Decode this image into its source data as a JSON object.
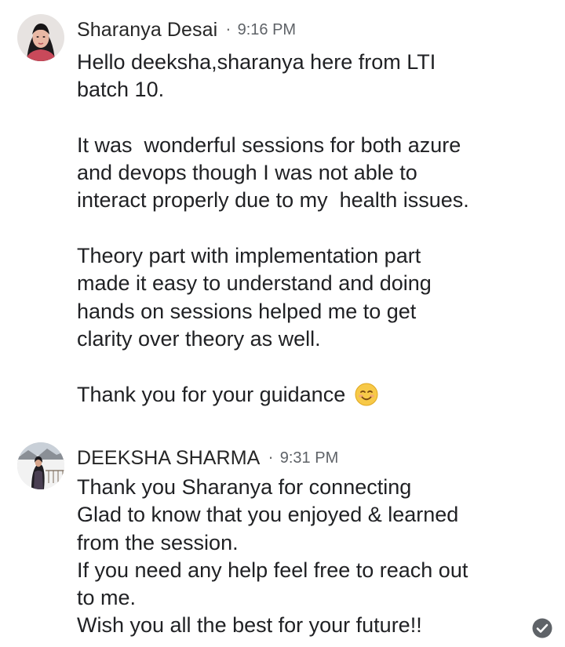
{
  "messages": [
    {
      "sender": "Sharanya Desai",
      "separator": "·",
      "time": "9:16 PM",
      "avatar_icon": "female-profile-photo",
      "lines": [
        "Hello deeksha,sharanya here from LTI",
        "batch 10.",
        "",
        "It was  wonderful sessions for both azure",
        "and devops though I was not able to",
        "interact properly due to my  health issues.",
        "",
        "Theory part with implementation part",
        "made it easy to understand and doing",
        "hands on sessions helped me to get",
        "clarity over theory as well.",
        "",
        "Thank you for your guidance "
      ],
      "trailing_emoji": "smiling-face-emoji"
    },
    {
      "sender": "DEEKSHA SHARMA",
      "separator": "·",
      "time": "9:31 PM",
      "avatar_icon": "female-outdoor-profile-photo",
      "lines": [
        "Thank you Sharanya for connecting",
        "Glad to know that you enjoyed & learned",
        "from the session.",
        "If you need any help feel free to reach out",
        "to me.",
        "Wish you all the best for your future!!"
      ],
      "status_icon": "seen-check-icon"
    }
  ],
  "colors": {
    "text": "#202124",
    "timestamp": "#5f6368",
    "emoji_face": "#f7c948",
    "check_badge": "#5f6368"
  }
}
